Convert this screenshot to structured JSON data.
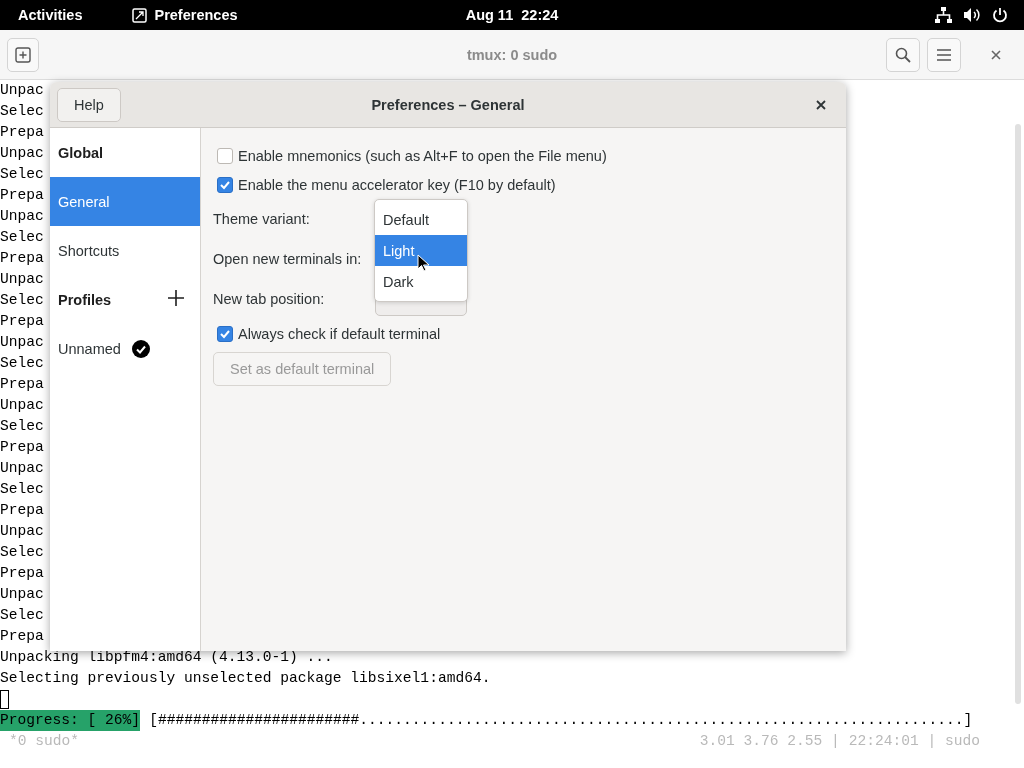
{
  "top_bar": {
    "activities": "Activities",
    "app_name": "Preferences",
    "clock": "Aug 11  22:24"
  },
  "terminal_window": {
    "title": "tmux: 0 sudo"
  },
  "terminal": {
    "partial_lines": [
      "Unpac",
      "Selec",
      "Prepa",
      "Unpac",
      "Selec",
      "Prepa",
      "Unpac",
      "Selec",
      "Prepa",
      "Unpac",
      "Selec",
      "Prepa",
      "Unpac",
      "Selec",
      "Prepa",
      "Unpac",
      "Selec",
      "Prepa",
      "Unpac",
      "Selec",
      "Prepa",
      "Unpac",
      "Selec",
      "Prepa",
      "Unpac",
      "Selec",
      "Prepa"
    ],
    "lines": [
      "Unpacking libpfm4:amd64 (4.13.0-1) ...",
      "Selecting previously unselected package libsixel1:amd64."
    ],
    "progress_label": "Progress: [ 26%]",
    "progress_bar": "[#######################.....................................................................]",
    "status_left": "*0 sudo*",
    "status_right": "3.01 3.76 2.55 | 22:24:01 | sudo"
  },
  "dialog": {
    "title": "Preferences – General",
    "help_button": "Help",
    "sidebar": [
      {
        "kind": "heading",
        "label": "Global"
      },
      {
        "kind": "item",
        "label": "General",
        "selected": true
      },
      {
        "kind": "item",
        "label": "Shortcuts",
        "selected": false
      },
      {
        "kind": "heading-add",
        "label": "Profiles"
      },
      {
        "kind": "profile",
        "label": "Unnamed",
        "selected": false
      }
    ],
    "settings": [
      {
        "kind": "checkbox",
        "label": "Enable mnemonics (such as Alt+F to open the File menu)",
        "checked": false
      },
      {
        "kind": "checkbox",
        "label": "Enable the menu accelerator key (F10 by default)",
        "checked": true
      },
      {
        "kind": "combo",
        "label": "Theme variant:"
      },
      {
        "kind": "combo",
        "label": "Open new terminals in:"
      },
      {
        "kind": "combo",
        "label": "New tab position:"
      },
      {
        "kind": "checkbox",
        "label": "Always check if default terminal",
        "checked": true
      },
      {
        "kind": "button",
        "label": "Set as default terminal",
        "disabled": true
      }
    ],
    "dropdown": [
      {
        "label": "Default",
        "selected": false
      },
      {
        "label": "Light",
        "selected": true
      },
      {
        "label": "Dark",
        "selected": false
      }
    ]
  }
}
